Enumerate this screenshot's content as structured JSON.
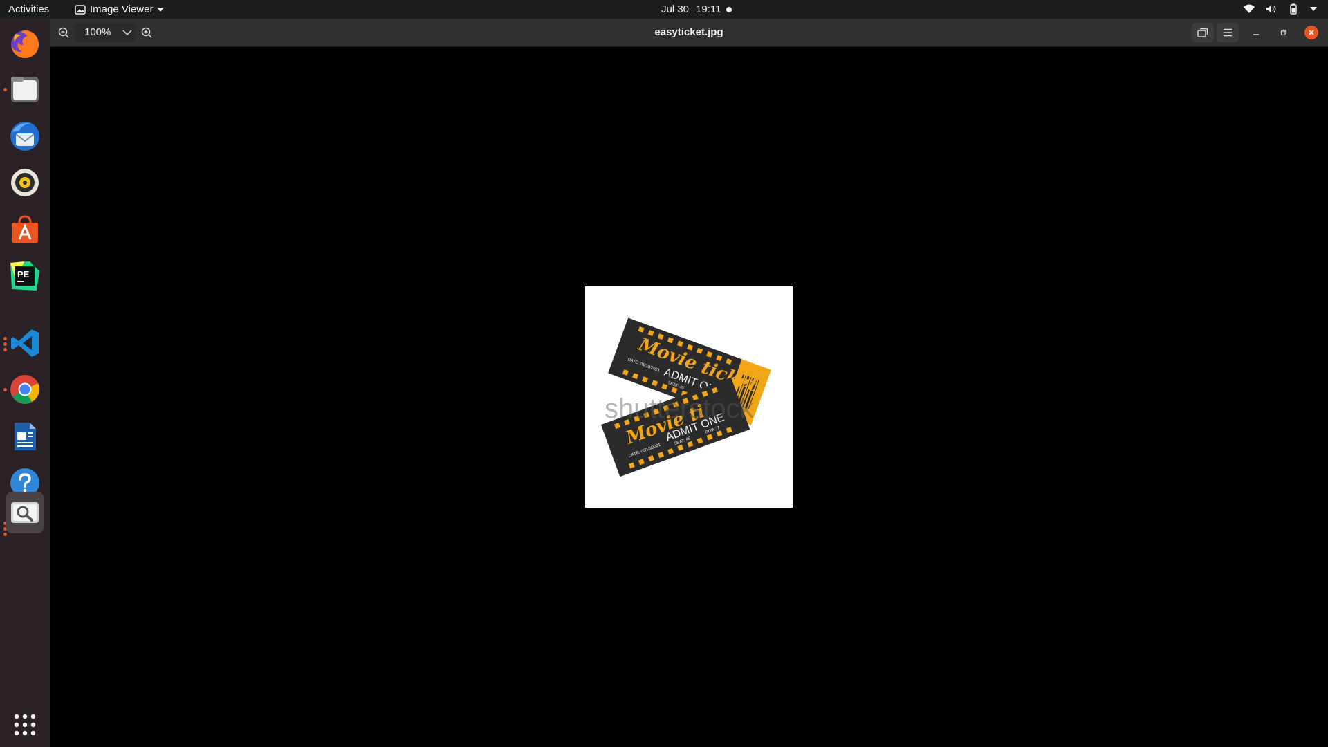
{
  "topbar": {
    "activities": "Activities",
    "app_name": "Image Viewer",
    "date": "Jul 30",
    "time": "19:11"
  },
  "dock": {
    "items": [
      {
        "name": "firefox",
        "running": false
      },
      {
        "name": "files",
        "running": true
      },
      {
        "name": "thunderbird",
        "running": false
      },
      {
        "name": "rhythmbox",
        "running": false
      },
      {
        "name": "ubuntu-software",
        "running": false
      },
      {
        "name": "pycharm-edu",
        "running": false
      },
      {
        "name": "vscode",
        "running": true
      },
      {
        "name": "chrome",
        "running": true
      },
      {
        "name": "libreoffice-writer",
        "running": false
      },
      {
        "name": "help",
        "running": false
      },
      {
        "name": "image-viewer",
        "running": true
      }
    ],
    "show_apps_icon": "grid-icon"
  },
  "header": {
    "zoom_level": "100%",
    "file_title": "easyticket.jpg"
  },
  "image": {
    "ticket_title": "Movie ticket",
    "ticket_title_partial": "Movie ti",
    "admit": "ADMIT ONE",
    "date": "DATE: 05/10/2021",
    "seat": "SEAT: 45",
    "row": "ROW: 7",
    "watermark": "shutterstock"
  },
  "colors": {
    "accent": "#e95420",
    "ticket_dark": "#2b2b2b",
    "ticket_gold": "#f2a516"
  }
}
